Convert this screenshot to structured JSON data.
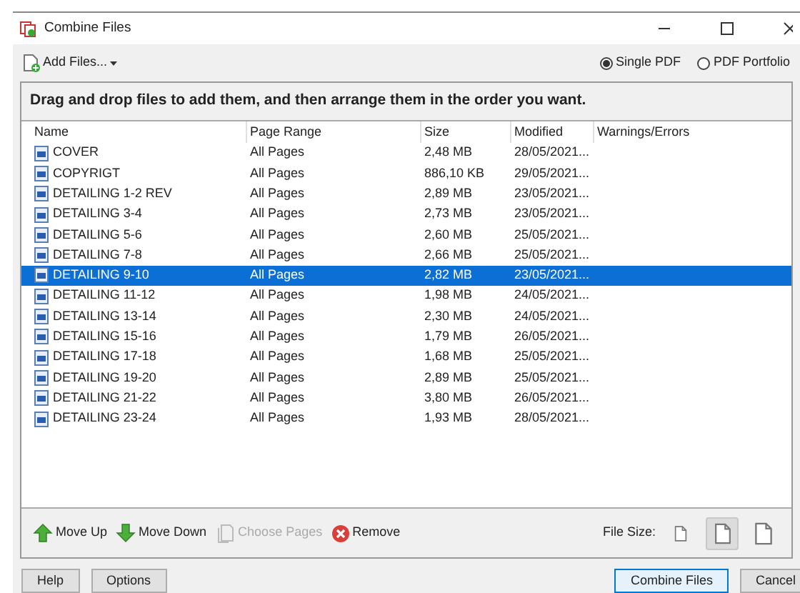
{
  "window": {
    "title": "Combine Files"
  },
  "toolbar": {
    "add_files": "Add Files...",
    "output": [
      {
        "label": "Single PDF",
        "selected": true
      },
      {
        "label": "PDF Portfolio",
        "selected": false
      }
    ]
  },
  "instruction": "Drag and drop files to add them, and then arrange them in the order you want.",
  "table": {
    "columns": [
      "Name",
      "Page Range",
      "Size",
      "Modified",
      "Warnings/Errors"
    ],
    "rows": [
      {
        "name": "COVER",
        "range": "All Pages",
        "size": "2,48 MB",
        "modified": "28/05/2021...",
        "selected": false
      },
      {
        "name": "COPYRIGT",
        "range": "All Pages",
        "size": "886,10 KB",
        "modified": "29/05/2021...",
        "selected": false
      },
      {
        "name": "DETAILING 1-2 REV",
        "range": "All Pages",
        "size": "2,89 MB",
        "modified": "23/05/2021...",
        "selected": false
      },
      {
        "name": "DETAILING 3-4",
        "range": "All Pages",
        "size": "2,73 MB",
        "modified": "23/05/2021...",
        "selected": false
      },
      {
        "name": "DETAILING 5-6",
        "range": "All Pages",
        "size": "2,60 MB",
        "modified": "25/05/2021...",
        "selected": false
      },
      {
        "name": "DETAILING 7-8",
        "range": "All Pages",
        "size": "2,66 MB",
        "modified": "25/05/2021...",
        "selected": false
      },
      {
        "name": "DETAILING 9-10",
        "range": "All Pages",
        "size": "2,82 MB",
        "modified": "23/05/2021...",
        "selected": true
      },
      {
        "name": "DETAILING 11-12",
        "range": "All Pages",
        "size": "1,98 MB",
        "modified": "24/05/2021...",
        "selected": false
      },
      {
        "name": "DETAILING 13-14",
        "range": "All Pages",
        "size": "2,30 MB",
        "modified": "24/05/2021...",
        "selected": false
      },
      {
        "name": "DETAILING 15-16",
        "range": "All Pages",
        "size": "1,79 MB",
        "modified": "26/05/2021...",
        "selected": false
      },
      {
        "name": "DETAILING 17-18",
        "range": "All Pages",
        "size": "1,68 MB",
        "modified": "25/05/2021...",
        "selected": false
      },
      {
        "name": "DETAILING 19-20",
        "range": "All Pages",
        "size": "2,89 MB",
        "modified": "25/05/2021...",
        "selected": false
      },
      {
        "name": "DETAILING 21-22",
        "range": "All Pages",
        "size": "3,80 MB",
        "modified": "26/05/2021...",
        "selected": false
      },
      {
        "name": "DETAILING 23-24",
        "range": "All Pages",
        "size": "1,93 MB",
        "modified": "28/05/2021...",
        "selected": false
      }
    ]
  },
  "actions": [
    {
      "kind": "up",
      "label": "Move Up",
      "disabled": false
    },
    {
      "kind": "down",
      "label": "Move Down",
      "disabled": false
    },
    {
      "kind": "pages",
      "label": "Choose Pages",
      "disabled": true
    },
    {
      "kind": "remove",
      "label": "Remove",
      "disabled": false
    }
  ],
  "file_size": {
    "label": "File Size:",
    "options": [
      {
        "kind": "small",
        "selected": false
      },
      {
        "kind": "medium",
        "selected": true
      },
      {
        "kind": "large",
        "selected": false
      }
    ]
  },
  "buttons": {
    "left": [
      "Help",
      "Options"
    ],
    "right": [
      {
        "label": "Combine Files",
        "default": true
      },
      {
        "label": "Cancel",
        "default": false
      }
    ]
  }
}
